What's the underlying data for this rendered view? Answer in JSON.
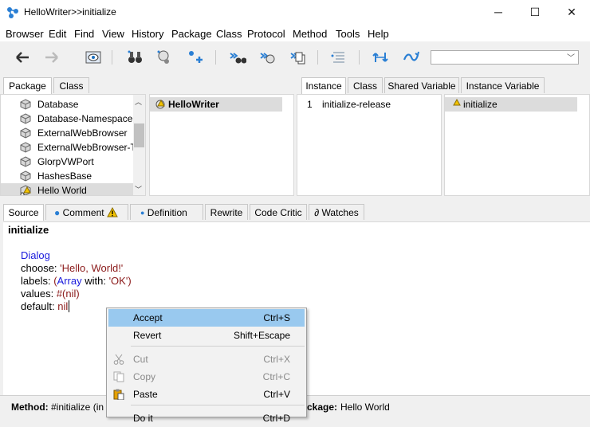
{
  "window": {
    "title": "HelloWriter>>initialize",
    "controls": {
      "minimize": "─",
      "maximize": "☐",
      "close": "✕"
    }
  },
  "menubar": [
    "Browser",
    "Edit",
    "Find",
    "View",
    "History",
    "Package",
    "Class",
    "Protocol",
    "Method",
    "Tools",
    "Help"
  ],
  "toolbar": {
    "icons": [
      "back-arrow-icon",
      "forward-arrow-icon",
      "browse-icon",
      "binoculars-icon",
      "senders-icon",
      "add-icon",
      "references-icon",
      "implementors-icon",
      "copy-icon",
      "format-icon",
      "sync-icon",
      "refresh-icon"
    ],
    "search_value": ""
  },
  "tabs_top_left": [
    "Package",
    "Class"
  ],
  "tabs_top_right": [
    "Instance",
    "Class",
    "Shared Variable",
    "Instance Variable"
  ],
  "packages": [
    "Database",
    "Database-Namespace",
    "ExternalWebBrowser",
    "ExternalWebBrowser-Te",
    "GlorpVWPort",
    "HashesBase",
    "Hello World"
  ],
  "classes": [
    "HelloWriter"
  ],
  "protocols": [
    {
      "num": "1",
      "name": "initialize-release"
    }
  ],
  "methods": [
    "initialize"
  ],
  "code_tabs": [
    "Source",
    "Comment",
    "Definition",
    "Rewrite",
    "Code Critic",
    "∂ Watches"
  ],
  "code": {
    "selector": "initialize",
    "lines": [
      "Dialog",
      "choose: 'Hello, World!'",
      "labels: (Array with: 'OK')",
      "values: #(nil)",
      "default: nil"
    ],
    "tokens": {
      "l1": "Dialog",
      "l2a": "choose: ",
      "l2b": "'Hello, World!'",
      "l3a": "labels: ",
      "l3b": "(",
      "l3c": "Array",
      "l3d": " with: ",
      "l3e": "'OK'",
      "l3f": ")",
      "l4a": "values: ",
      "l4b": "#(nil)",
      "l5a": "default: ",
      "l5b": "nil"
    }
  },
  "status": {
    "method_label": "Method:",
    "method_value": "#initialize (in",
    "package_label": "ckage:",
    "package_value": "Hello World"
  },
  "context_menu": [
    {
      "label": "Accept",
      "shortcut": "Ctrl+S",
      "state": "highlighted"
    },
    {
      "label": "Revert",
      "shortcut": "Shift+Escape",
      "state": "normal"
    },
    {
      "label": "Cut",
      "shortcut": "Ctrl+X",
      "state": "disabled"
    },
    {
      "label": "Copy",
      "shortcut": "Ctrl+C",
      "state": "disabled"
    },
    {
      "label": "Paste",
      "shortcut": "Ctrl+V",
      "state": "normal"
    },
    {
      "label": "Do it",
      "shortcut": "Ctrl+D",
      "state": "normal"
    }
  ]
}
